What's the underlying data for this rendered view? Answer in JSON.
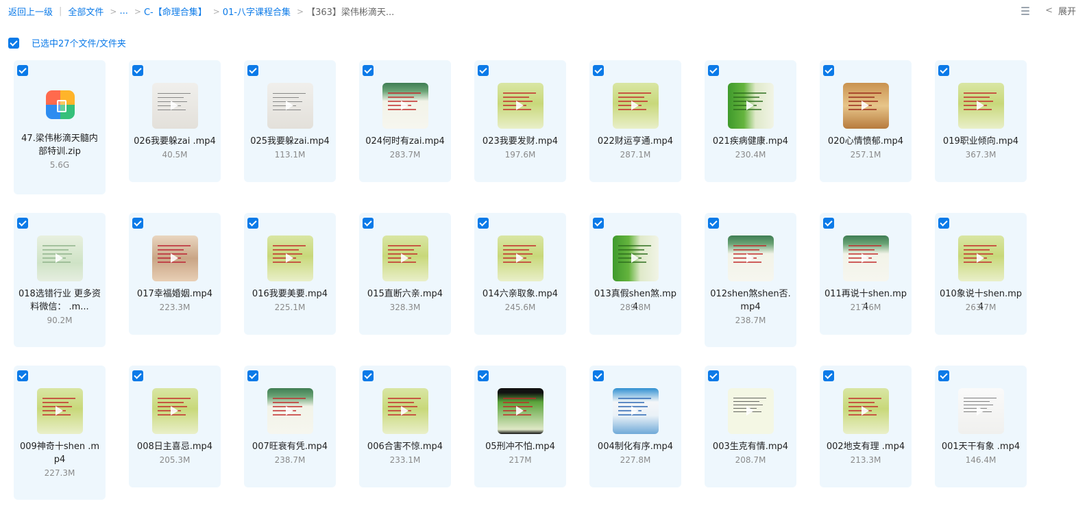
{
  "breadcrumb": {
    "back": "返回上一级",
    "all_files": "全部文件",
    "ellipsis": "...",
    "item1": "C-【命理合集】",
    "item2": "01-八字课程合集",
    "current": "【363】梁伟彬滴天..."
  },
  "toolbar": {
    "expand_label": "展开"
  },
  "selection": {
    "text": "已选中27个文件/文件夹"
  },
  "files": [
    {
      "name": "47.梁伟彬滴天髓内部特训.zip",
      "size": "5.6G",
      "kind": "zip",
      "thumb": "zip"
    },
    {
      "name": "026我要躲zai .mp4",
      "size": "40.5M",
      "kind": "video",
      "thumb": "gray"
    },
    {
      "name": "025我要躲zai.mp4",
      "size": "113.1M",
      "kind": "video",
      "thumb": "gray"
    },
    {
      "name": "024何时有zai.mp4",
      "size": "283.7M",
      "kind": "video",
      "thumb": "green-top"
    },
    {
      "name": "023我要发财.mp4",
      "size": "197.6M",
      "kind": "video",
      "thumb": "yellowgreen"
    },
    {
      "name": "022财运亨通.mp4",
      "size": "287.1M",
      "kind": "video",
      "thumb": "yellowgreen"
    },
    {
      "name": "021疾病健康.mp4",
      "size": "230.4M",
      "kind": "video",
      "thumb": "bamboo"
    },
    {
      "name": "020心情愤郁.mp4",
      "size": "257.1M",
      "kind": "video",
      "thumb": "brown"
    },
    {
      "name": "019职业倾向.mp4",
      "size": "367.3M",
      "kind": "video",
      "thumb": "yellowgreen"
    },
    {
      "name": "018选错行业 更多资料微信： .m...",
      "size": "90.2M",
      "kind": "video",
      "thumb": "lightgreen"
    },
    {
      "name": "017幸福婚姻.mp4",
      "size": "223.3M",
      "kind": "video",
      "thumb": "girl"
    },
    {
      "name": "016我要美要.mp4",
      "size": "225.1M",
      "kind": "video",
      "thumb": "yellowgreen"
    },
    {
      "name": "015直断六亲.mp4",
      "size": "328.3M",
      "kind": "video",
      "thumb": "yellowgreen"
    },
    {
      "name": "014六亲取象.mp4",
      "size": "245.6M",
      "kind": "video",
      "thumb": "yellowgreen"
    },
    {
      "name": "013真假shen煞.mp4",
      "size": "289.8M",
      "kind": "video",
      "thumb": "bamboo"
    },
    {
      "name": "012shen煞shen否.mp4",
      "size": "238.7M",
      "kind": "video",
      "thumb": "green-top"
    },
    {
      "name": "011再说十shen.mp4",
      "size": "217.6M",
      "kind": "video",
      "thumb": "green-top"
    },
    {
      "name": "010象说十shen.mp4",
      "size": "263.7M",
      "kind": "video",
      "thumb": "yellowgreen"
    },
    {
      "name": "009神奇十shen .mp4",
      "size": "227.3M",
      "kind": "video",
      "thumb": "yellowgreen"
    },
    {
      "name": "008日主喜忌.mp4",
      "size": "205.3M",
      "kind": "video",
      "thumb": "yellowgreen"
    },
    {
      "name": "007旺衰有凭.mp4",
      "size": "238.7M",
      "kind": "video",
      "thumb": "green-top"
    },
    {
      "name": "006合害不惊.mp4",
      "size": "233.1M",
      "kind": "video",
      "thumb": "yellowgreen"
    },
    {
      "name": "05刑冲不怕.mp4",
      "size": "217M",
      "kind": "video",
      "thumb": "dark"
    },
    {
      "name": "004制化有序.mp4",
      "size": "227.8M",
      "kind": "video",
      "thumb": "blue"
    },
    {
      "name": "003生克有情.mp4",
      "size": "208.7M",
      "kind": "video",
      "thumb": "diagram"
    },
    {
      "name": "002地支有理 .mp4",
      "size": "213.3M",
      "kind": "video",
      "thumb": "yellowgreen"
    },
    {
      "name": "001天干有象 .mp4",
      "size": "146.4M",
      "kind": "video",
      "thumb": "white"
    }
  ]
}
